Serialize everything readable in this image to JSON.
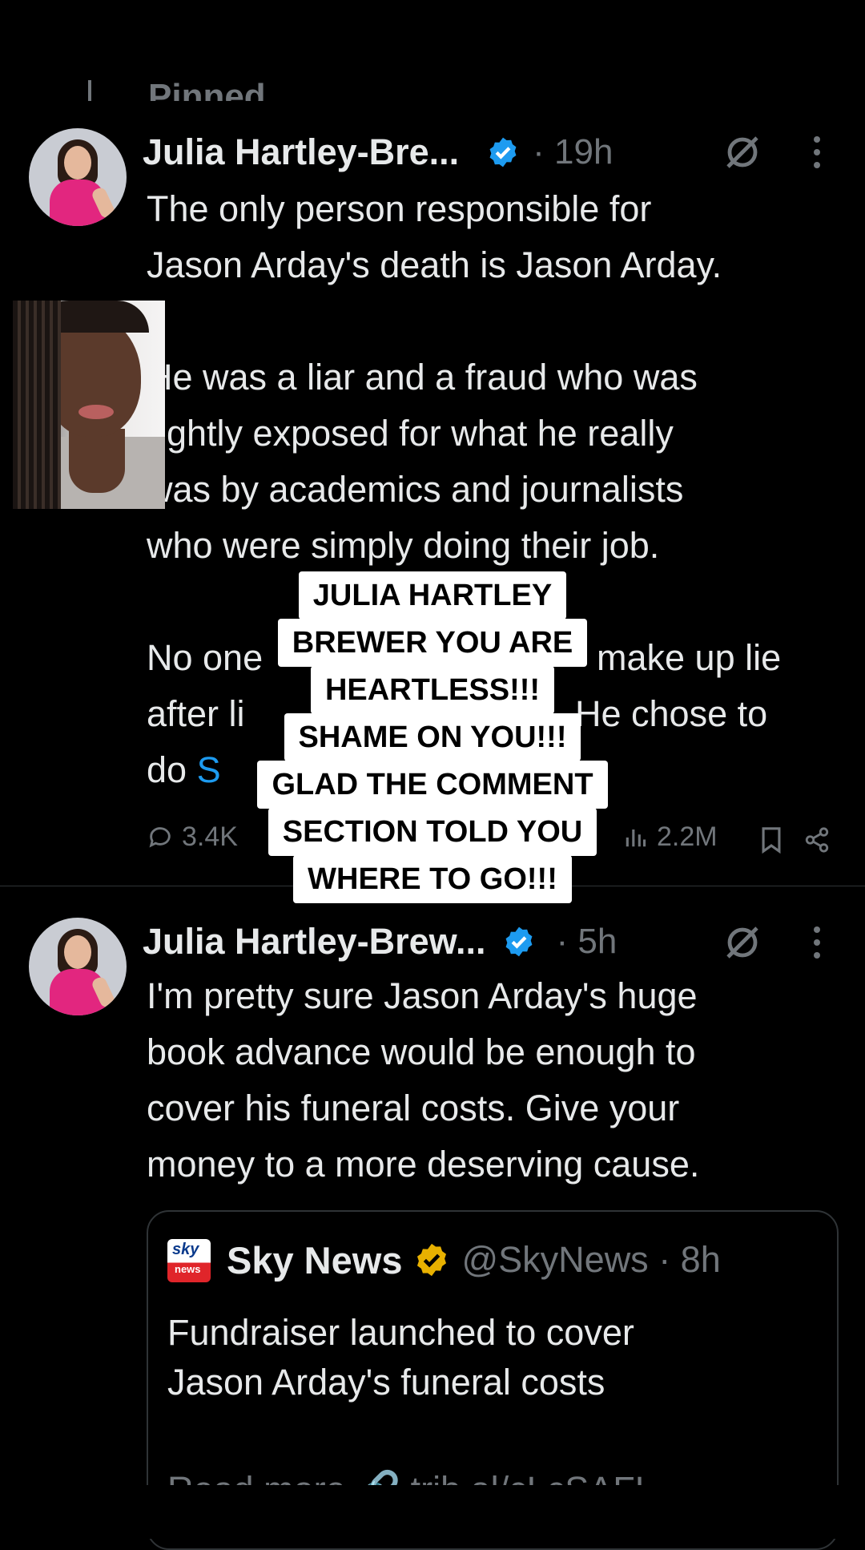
{
  "pinned_label": "Pinned",
  "tweets": [
    {
      "name": "Julia Hartley-Bre...",
      "time": "· 19h",
      "text_main": "The only person responsible for\nJason Arday's death is Jason Arday.\n\nHe was a liar and a fraud who was\nrightly exposed for what he really\nwas by academics and journalists\nwho were simply doing their job.\n\nNo one",
      "text_hidden_line1_end": "make up lie",
      "text_line2_start": "after li",
      "text_line2_end": "He chose to",
      "text_line3_start": "do ",
      "text_line3_link": "S",
      "replies": "3.4K",
      "views": "2.2M"
    },
    {
      "name": "Julia Hartley-Brew...",
      "time": "· 5h",
      "text": "I'm pretty sure Jason Arday's huge\nbook advance would be enough to\ncover his funeral costs. Give your\nmoney to a more deserving cause.",
      "quote": {
        "logo_text_top": "sky",
        "logo_text_bottom": "news",
        "name": "Sky News",
        "handle_time": "@SkyNews · 8h",
        "text": "Fundraiser launched to cover\nJason Arday's funeral costs",
        "read_more": "Read more 🔗 trib.al/cLcSAFL"
      }
    }
  ],
  "caption_lines": [
    "JULIA HARTLEY",
    "BREWER YOU ARE",
    "HEARTLESS!!!",
    "SHAME ON YOU!!!",
    "GLAD THE COMMENT",
    "SECTION TOLD YOU",
    "WHERE TO GO!!!"
  ],
  "colors": {
    "background": "#000000",
    "text": "#e7e9ea",
    "muted": "#71767b",
    "link": "#1d9bf0",
    "verified_blue": "#1d9bf0",
    "verified_gold": "#e8b100"
  }
}
